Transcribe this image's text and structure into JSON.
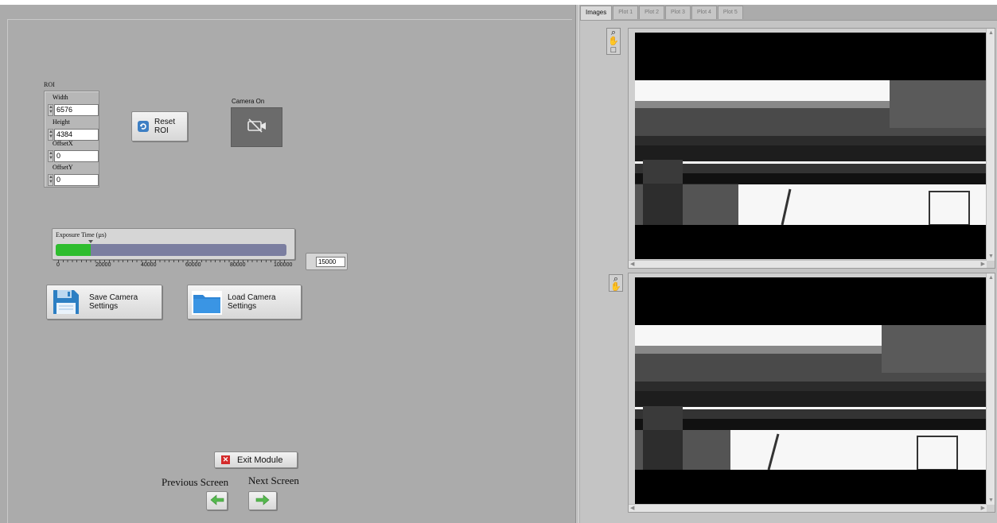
{
  "roi": {
    "label": "ROI",
    "fields": [
      {
        "label": "Width",
        "value": "6576"
      },
      {
        "label": "Height",
        "value": "4384"
      },
      {
        "label": "OffsetX",
        "value": "0"
      },
      {
        "label": "OffsetY",
        "value": "0"
      }
    ]
  },
  "buttons": {
    "reset_roi": "Reset ROI",
    "save_settings": "Save Camera Settings",
    "load_settings": "Load Camera Settings",
    "exit_module": "Exit Module"
  },
  "camera": {
    "label": "Camera On",
    "state": "off"
  },
  "exposure": {
    "label": "Exposure Time (µs)",
    "ticks": [
      "0",
      "20000",
      "40000",
      "60000",
      "80000",
      "100000"
    ],
    "value": "15000",
    "fraction": 0.15,
    "fill_color": "#2ebd2e"
  },
  "nav": {
    "previous": "Previous Screen",
    "next": "Next Screen"
  },
  "tabs": [
    "Images",
    "Plot 1",
    "Plot 2",
    "Plot 3",
    "Plot 4",
    "Plot 5"
  ],
  "active_tab": 0,
  "icons": {
    "reset": "refresh-icon",
    "camera": "camera-off-icon",
    "save": "floppy-disk-icon",
    "load": "folder-icon",
    "exit": "close-icon",
    "prev": "arrow-left-icon",
    "next": "arrow-right-icon",
    "zoom": "zoom-icon",
    "pan": "hand-icon"
  }
}
